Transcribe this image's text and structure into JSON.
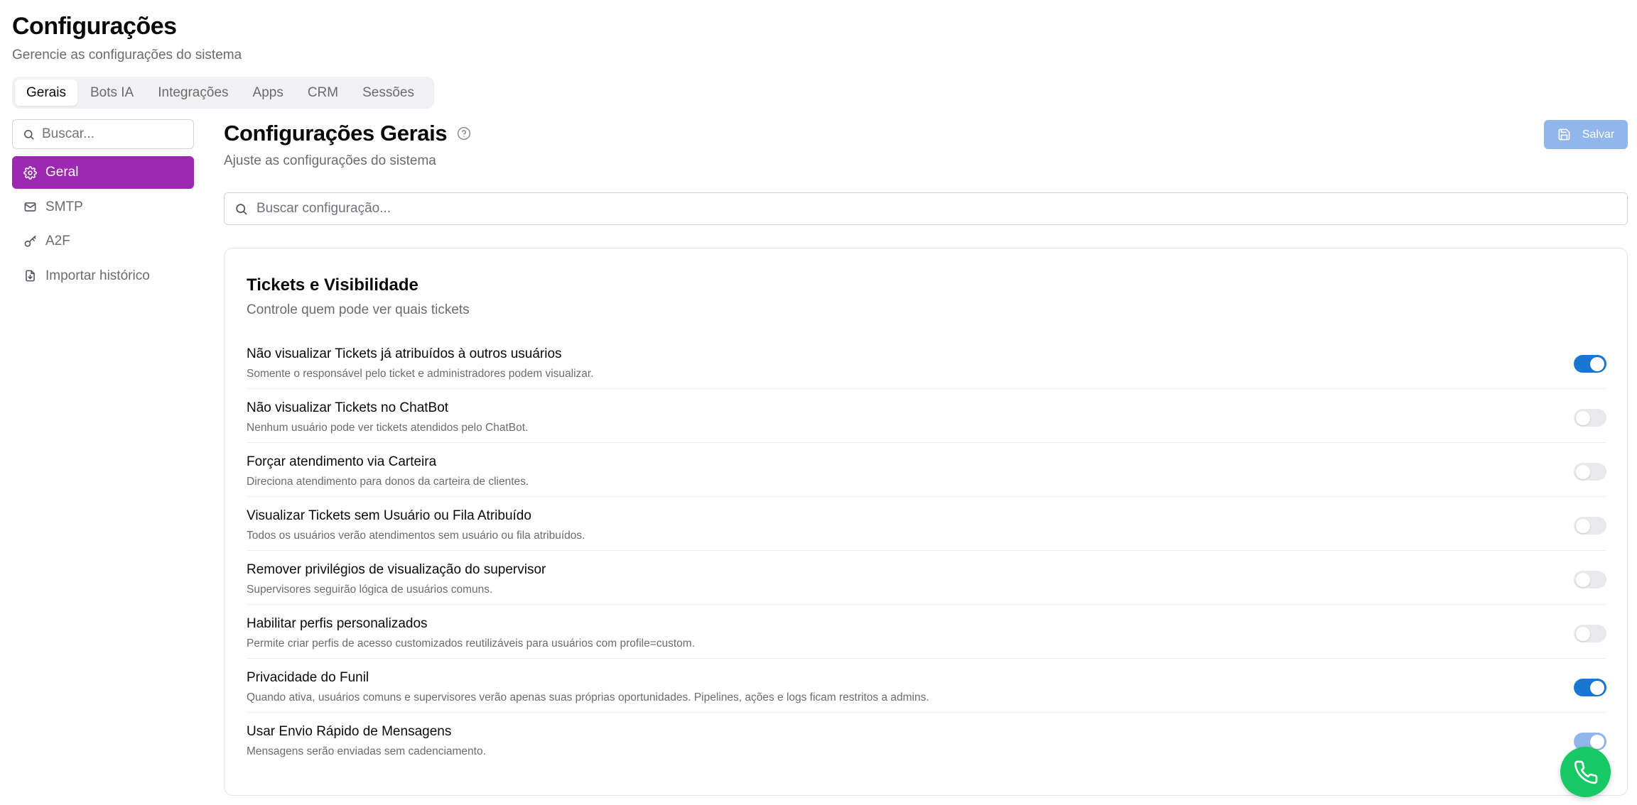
{
  "header": {
    "title": "Configurações",
    "subtitle": "Gerencie as configurações do sistema"
  },
  "tabs": [
    {
      "label": "Gerais",
      "active": true
    },
    {
      "label": "Bots IA",
      "active": false
    },
    {
      "label": "Integrações",
      "active": false
    },
    {
      "label": "Apps",
      "active": false
    },
    {
      "label": "CRM",
      "active": false
    },
    {
      "label": "Sessões",
      "active": false
    }
  ],
  "sidebar": {
    "search_placeholder": "Buscar...",
    "items": [
      {
        "label": "Geral",
        "icon": "gear-icon",
        "active": true
      },
      {
        "label": "SMTP",
        "icon": "mail-icon",
        "active": false
      },
      {
        "label": "A2F",
        "icon": "key-icon",
        "active": false
      },
      {
        "label": "Importar histórico",
        "icon": "file-import-icon",
        "active": false
      }
    ]
  },
  "main": {
    "title": "Configurações Gerais",
    "subtitle": "Ajuste as configurações do sistema",
    "save_label": "Salvar",
    "search_placeholder": "Buscar configuração..."
  },
  "section": {
    "title": "Tickets e Visibilidade",
    "description": "Controle quem pode ver quais tickets",
    "settings": [
      {
        "label": "Não visualizar Tickets já atribuídos à outros usuários",
        "hint": "Somente o responsável pelo ticket e administradores podem visualizar.",
        "enabled": true
      },
      {
        "label": "Não visualizar Tickets no ChatBot",
        "hint": "Nenhum usuário pode ver tickets atendidos pelo ChatBot.",
        "enabled": false
      },
      {
        "label": "Forçar atendimento via Carteira",
        "hint": "Direciona atendimento para donos da carteira de clientes.",
        "enabled": false
      },
      {
        "label": "Visualizar Tickets sem Usuário ou Fila Atribuído",
        "hint": "Todos os usuários verão atendimentos sem usuário ou fila atribuídos.",
        "enabled": false
      },
      {
        "label": "Remover privilégios de visualização do supervisor",
        "hint": "Supervisores seguirão lógica de usuários comuns.",
        "enabled": false
      },
      {
        "label": "Habilitar perfis personalizados",
        "hint": "Permite criar perfis de acesso customizados reutilizáveis para usuários com profile=custom.",
        "enabled": false
      },
      {
        "label": "Privacidade do Funil",
        "hint": "Quando ativa, usuários comuns e supervisores verão apenas suas próprias oportunidades. Pipelines, ações e logs ficam restritos a admins.",
        "enabled": true
      },
      {
        "label": "Usar Envio Rápido de Mensagens",
        "hint": "Mensagens serão enviadas sem cadenciamento.",
        "enabled": true
      }
    ]
  },
  "colors": {
    "accent_purple": "#9c27b0",
    "toggle_on": "#1976d2",
    "save_button": "#90b6ec",
    "fab_green": "#17c964"
  },
  "fab": {
    "icon": "phone-icon"
  }
}
